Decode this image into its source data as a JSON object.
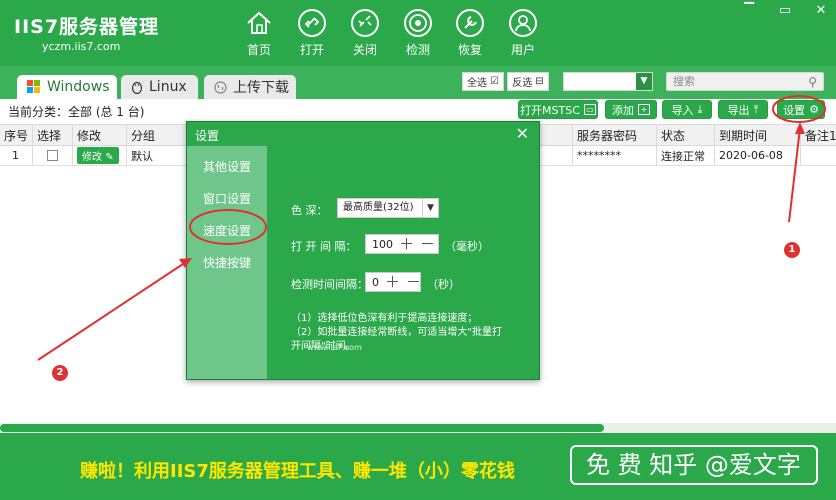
{
  "app": {
    "logo_main": "IIS7服务器管理",
    "logo_url": "yczm.iis7.com"
  },
  "nav": [
    {
      "label": "首页",
      "icon": "home-icon"
    },
    {
      "label": "打开",
      "icon": "link-icon"
    },
    {
      "label": "关闭",
      "icon": "unlink-icon"
    },
    {
      "label": "检测",
      "icon": "detect-icon"
    },
    {
      "label": "恢复",
      "icon": "wrench-icon"
    },
    {
      "label": "用户",
      "icon": "user-icon"
    }
  ],
  "window_controls": {
    "minimize": "▔",
    "maximize": "▭",
    "close": "✕"
  },
  "tabs": [
    {
      "label": "Windows",
      "icon": "windows-icon"
    },
    {
      "label": "Linux",
      "icon": "linux-icon"
    },
    {
      "label": "上传下载",
      "icon": "upload-icon"
    }
  ],
  "selection": {
    "select_all": "全选",
    "invert": "反选"
  },
  "filter_dropdown": {
    "value": ""
  },
  "search": {
    "placeholder": "搜索"
  },
  "toolbar": {
    "current_category": "当前分类：全部 (总 1 台)",
    "open_mstsc": "打开MSTSC",
    "add": "添加",
    "import": "导入",
    "export": "导出",
    "settings": "设置"
  },
  "table": {
    "columns": [
      "序号",
      "选择",
      "修改",
      "分组",
      "服务器密码",
      "状态",
      "到期时间",
      "备注1"
    ],
    "rows": [
      {
        "index": "1",
        "edit": "修改",
        "group": "默认",
        "password": "********",
        "status": "连接正常",
        "expiry": "2020-06-08"
      }
    ]
  },
  "dialog": {
    "title": "设置",
    "close": "✕",
    "sidebar": [
      "其他设置",
      "窗口设置",
      "速度设置",
      "快捷按键"
    ],
    "active_item": "速度设置",
    "color_depth_label": "色   深：",
    "color_depth_value": "最高质量(32位)",
    "open_interval_label": "打 开 间 隔：",
    "open_interval_value": "100",
    "open_interval_unit": "（毫秒）",
    "check_interval_label": "检测时间间隔：",
    "check_interval_value": "0",
    "check_interval_unit": "（秒）",
    "note1": "（1）选择低位色深有利于提高连接速度；",
    "note2": "（2）如批量连接经常断线，可适当增大\"批量打开间隔\"时间。",
    "watermark": "www.iis7.com"
  },
  "annotations": {
    "marker1": "1",
    "marker2": "2"
  },
  "banner": {
    "prefix": "赚啦！利用IIS7服务器管理工具、赚一堆（小）",
    "highlight": "零花钱",
    "free_box": "免 费 知乎 @爱文字"
  },
  "colors": {
    "primary": "#2aa84a",
    "sidebar": "#6fc68a",
    "annotation": "#e03030",
    "highlight": "#ffe600"
  }
}
